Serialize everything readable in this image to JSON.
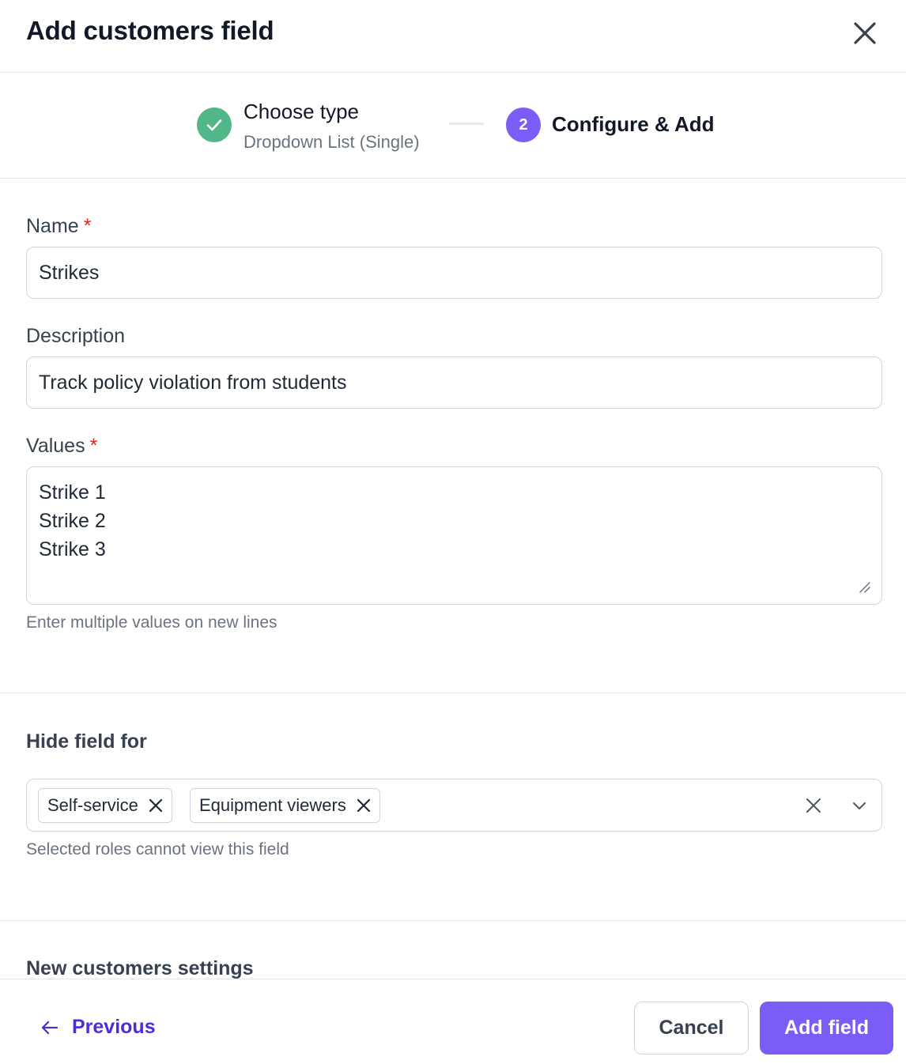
{
  "dialog": {
    "title": "Add customers field"
  },
  "stepper": {
    "step1": {
      "title": "Choose type",
      "subtitle": "Dropdown List (Single)",
      "status": "complete"
    },
    "step2": {
      "number": "2",
      "title": "Configure & Add",
      "status": "active"
    }
  },
  "form": {
    "name": {
      "label": "Name",
      "required_mark": "*",
      "value": "Strikes"
    },
    "description": {
      "label": "Description",
      "value": "Track policy violation from students"
    },
    "values": {
      "label": "Values",
      "required_mark": "*",
      "lines": [
        "Strike 1",
        "Strike 2",
        "Strike 3"
      ],
      "help": "Enter multiple values on new lines"
    }
  },
  "hide_field": {
    "title": "Hide field for",
    "selected": [
      "Self-service",
      "Equipment viewers"
    ],
    "help": "Selected roles cannot view this field"
  },
  "new_customers": {
    "title": "New customers settings"
  },
  "footer": {
    "previous_label": "Previous",
    "cancel_label": "Cancel",
    "add_label": "Add field"
  },
  "colors": {
    "accent": "#7c5cf6",
    "success": "#52b788",
    "link": "#4f2bd9",
    "required": "#dc2626"
  },
  "icons": [
    "close-icon",
    "check-icon",
    "resize-handle-icon",
    "chip-remove-icon",
    "clear-icon",
    "chevron-down-icon",
    "arrow-left-icon"
  ]
}
